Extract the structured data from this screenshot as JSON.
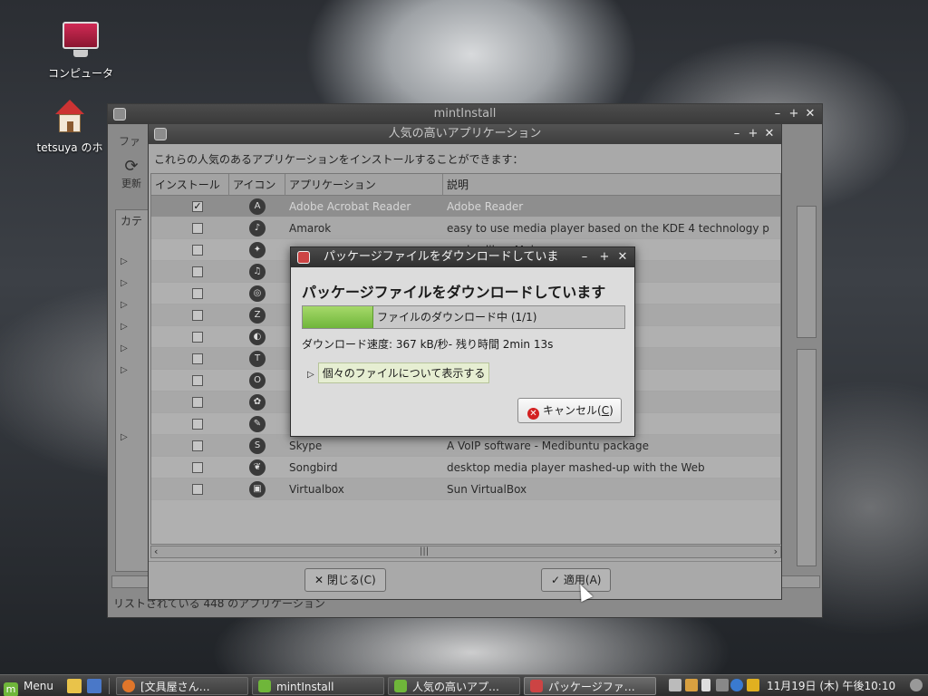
{
  "desktop": {
    "icons": [
      {
        "label": "コンピュータ"
      },
      {
        "label": "tetsuya のホ"
      }
    ]
  },
  "mintinstall": {
    "title": "mintInstall",
    "menu_label": "ファ",
    "refresh_label": "更新",
    "category_label": "カテ",
    "status": "リストされている 448 のアプリケーション"
  },
  "popular": {
    "title": "人気の高いアプリケーション",
    "description": "これらの人気のあるアプリケーションをインストールすることができます：",
    "columns": [
      "インストール",
      "アイコン",
      "アプリケーション",
      "説明"
    ],
    "rows": [
      {
        "checked": true,
        "name": "Adobe Acrobat Reader",
        "desc": "Adobe Reader",
        "icon": "acrobat-icon"
      },
      {
        "checked": false,
        "name": "Amarok",
        "desc": "easy to use media player based on the KDE 4 technology p",
        "icon": "amarok-icon"
      },
      {
        "checked": false,
        "name": "",
        "desc": "works, like eMule",
        "icon": "amule-icon"
      },
      {
        "checked": false,
        "name": "",
        "desc": "tor",
        "icon": "headphones-icon"
      },
      {
        "checked": false,
        "name": "",
        "desc": "cation",
        "icon": "chromium-icon"
      },
      {
        "checked": false,
        "name": "",
        "desc": "ical FTP client",
        "icon": "filezilla-icon"
      },
      {
        "checked": false,
        "name": "",
        "desc": "",
        "icon": "earth-icon"
      },
      {
        "checked": false,
        "name": "",
        "desc": "",
        "icon": "font-icon"
      },
      {
        "checked": false,
        "name": "",
        "desc": "",
        "icon": "opera-icon"
      },
      {
        "checked": false,
        "name": "",
        "desc": "om Google",
        "icon": "picasa-icon"
      },
      {
        "checked": false,
        "name": "",
        "desc": "",
        "icon": "scribus-icon"
      },
      {
        "checked": false,
        "name": "Skype",
        "desc": "A VoIP software - Medibuntu package",
        "icon": "skype-icon"
      },
      {
        "checked": false,
        "name": "Songbird",
        "desc": "desktop media player mashed-up with the Web",
        "icon": "songbird-icon"
      },
      {
        "checked": false,
        "name": "Virtualbox",
        "desc": "Sun VirtualBox",
        "icon": "virtualbox-icon"
      }
    ],
    "close_label": "閉じる(C)",
    "apply_label": "適用(A)"
  },
  "download": {
    "title": "パッケージファイルをダウンロードしていま",
    "heading": "パッケージファイルをダウンロードしています",
    "progress_fraction": 0.22,
    "progress_text": "ファイルのダウンロード中 (1/1)",
    "speed_text": "ダウンロード速度: 367 kB/秒- 残り時間 2min 13s",
    "expander_label": "個々のファイルについて表示する",
    "cancel_label": "キャンセル(",
    "cancel_mnemonic": "C",
    "cancel_suffix": ")"
  },
  "taskbar": {
    "menu_label": "Menu",
    "tasks": [
      {
        "label": "[文具屋さん…"
      },
      {
        "label": "mintInstall"
      },
      {
        "label": "人気の高いアプ…"
      },
      {
        "label": "パッケージファ…"
      }
    ],
    "clock": "11月19日 (木) 午後10:10"
  },
  "colors": {
    "progress_green": "#6fb63a",
    "mint_green": "#6fb63a",
    "cancel_red": "#d32020"
  }
}
